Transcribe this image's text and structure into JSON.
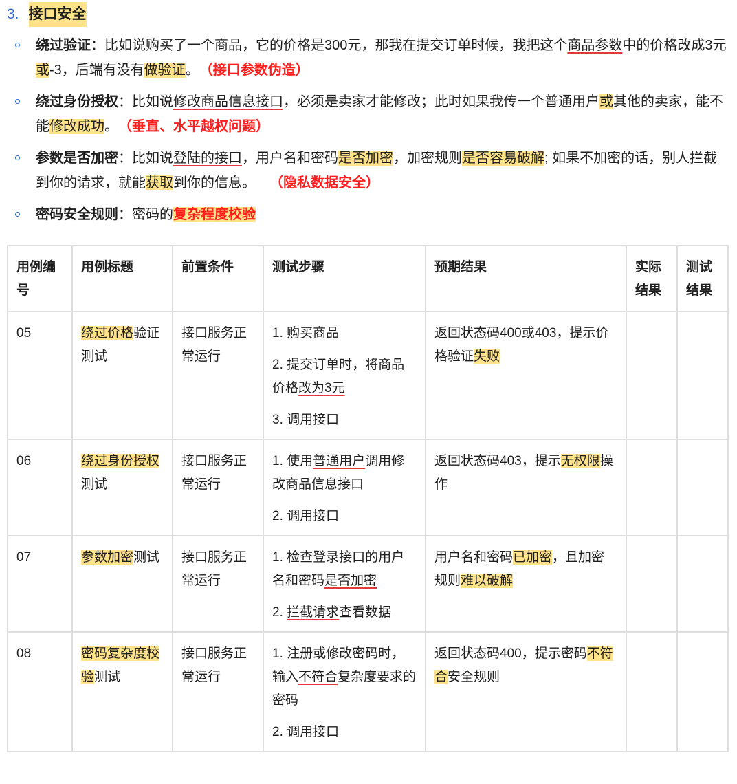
{
  "section": {
    "number": "3.",
    "title": "接口安全"
  },
  "bullets": [
    {
      "label": "绕过验证",
      "parts": [
        {
          "t": "：比如说购买了一个商品，它的价格是300元，那我在提交订单时候，我把这个"
        },
        {
          "t": "商品参数",
          "s": "ul"
        },
        {
          "t": "中的价格改成3元"
        },
        {
          "t": "或",
          "s": "hl"
        },
        {
          "t": "-3，后端有没有"
        },
        {
          "t": "做验证",
          "s": "hl"
        },
        {
          "t": "。　"
        },
        {
          "t": "（接口参数伪造）",
          "s": "red"
        }
      ]
    },
    {
      "label": "绕过身份授权",
      "parts": [
        {
          "t": "：比如说"
        },
        {
          "t": "修改商品信息接口",
          "s": "ul"
        },
        {
          "t": "，必须是卖家才能修改；此时如果我传一个普通用户"
        },
        {
          "t": "或",
          "s": "hl"
        },
        {
          "t": "其他的卖家，能不能"
        },
        {
          "t": "修改成功",
          "s": "hl"
        },
        {
          "t": "。　"
        },
        {
          "t": "（垂直、水平越权问题）",
          "s": "red"
        }
      ]
    },
    {
      "label": "参数是否加密",
      "parts": [
        {
          "t": "：比如说"
        },
        {
          "t": "登陆的接口",
          "s": "ul"
        },
        {
          "t": "，用户名和密码"
        },
        {
          "t": "是否加密",
          "s": "hl"
        },
        {
          "t": "，加密规则"
        },
        {
          "t": "是否容易破解",
          "s": "hl"
        },
        {
          "t": "; 如果不加密的话，别人拦截到你的请求，就能"
        },
        {
          "t": "获取",
          "s": "hl"
        },
        {
          "t": "到你的信息。　　"
        },
        {
          "t": "（隐私数据安全）",
          "s": "red"
        }
      ]
    },
    {
      "label": "密码安全规则",
      "parts": [
        {
          "t": "：密码的"
        },
        {
          "t": "复杂程度校验",
          "s": "red hl"
        }
      ]
    }
  ],
  "table": {
    "headers": [
      "用例编号",
      "用例标题",
      "前置条件",
      "测试步骤",
      "预期结果",
      "实际结果",
      "测试结果"
    ],
    "rows": [
      {
        "id": "05",
        "title": [
          {
            "t": "绕过价格",
            "s": "hl"
          },
          {
            "t": "验证测试"
          }
        ],
        "precondition": "接口服务正常运行",
        "steps": [
          [
            {
              "t": "1. 购买商品"
            }
          ],
          [
            {
              "t": "2. 提交订单时，将商品价格"
            },
            {
              "t": "改为3元",
              "s": "ul"
            }
          ],
          [
            {
              "t": "3. 调用接口"
            }
          ]
        ],
        "expected": [
          {
            "t": "返回状态码400或403，提示价格验证"
          },
          {
            "t": "失败",
            "s": "hl"
          }
        ],
        "actual": "",
        "result": ""
      },
      {
        "id": "06",
        "title": [
          {
            "t": "绕过身份授权",
            "s": "hl"
          },
          {
            "t": "测试"
          }
        ],
        "precondition": "接口服务正常运行",
        "steps": [
          [
            {
              "t": "1. 使用"
            },
            {
              "t": "普通用户",
              "s": "ul"
            },
            {
              "t": "调用修改商品信息接口"
            }
          ],
          [
            {
              "t": "2. 调用接口"
            }
          ]
        ],
        "expected": [
          {
            "t": "返回状态码403，提示"
          },
          {
            "t": "无权限",
            "s": "hl"
          },
          {
            "t": "操作"
          }
        ],
        "actual": "",
        "result": ""
      },
      {
        "id": "07",
        "title": [
          {
            "t": "参数加密",
            "s": "hl"
          },
          {
            "t": "测试"
          }
        ],
        "precondition": "接口服务正常运行",
        "steps": [
          [
            {
              "t": "1. 检查登录接口的用户名和密码"
            },
            {
              "t": "是否加密",
              "s": "ul"
            }
          ],
          [
            {
              "t": "2. "
            },
            {
              "t": "拦截请求",
              "s": "ul"
            },
            {
              "t": "查看数据"
            }
          ]
        ],
        "expected": [
          {
            "t": "用户名和密码"
          },
          {
            "t": "已加密",
            "s": "hl"
          },
          {
            "t": "，且加密规则"
          },
          {
            "t": "难以破解",
            "s": "hl"
          }
        ],
        "actual": "",
        "result": ""
      },
      {
        "id": "08",
        "title": [
          {
            "t": "密码复杂度校验",
            "s": "hl"
          },
          {
            "t": "测试"
          }
        ],
        "precondition": "接口服务正常运行",
        "steps": [
          [
            {
              "t": "1. 注册或修改密码时，输入"
            },
            {
              "t": "不符合",
              "s": "ul"
            },
            {
              "t": "复杂度要求的密码"
            }
          ],
          [
            {
              "t": "2. 调用接口"
            }
          ]
        ],
        "expected": [
          {
            "t": "返回状态码400，提示密码"
          },
          {
            "t": "不符合",
            "s": "hl"
          },
          {
            "t": "安全规则"
          }
        ],
        "actual": "",
        "result": ""
      }
    ]
  }
}
